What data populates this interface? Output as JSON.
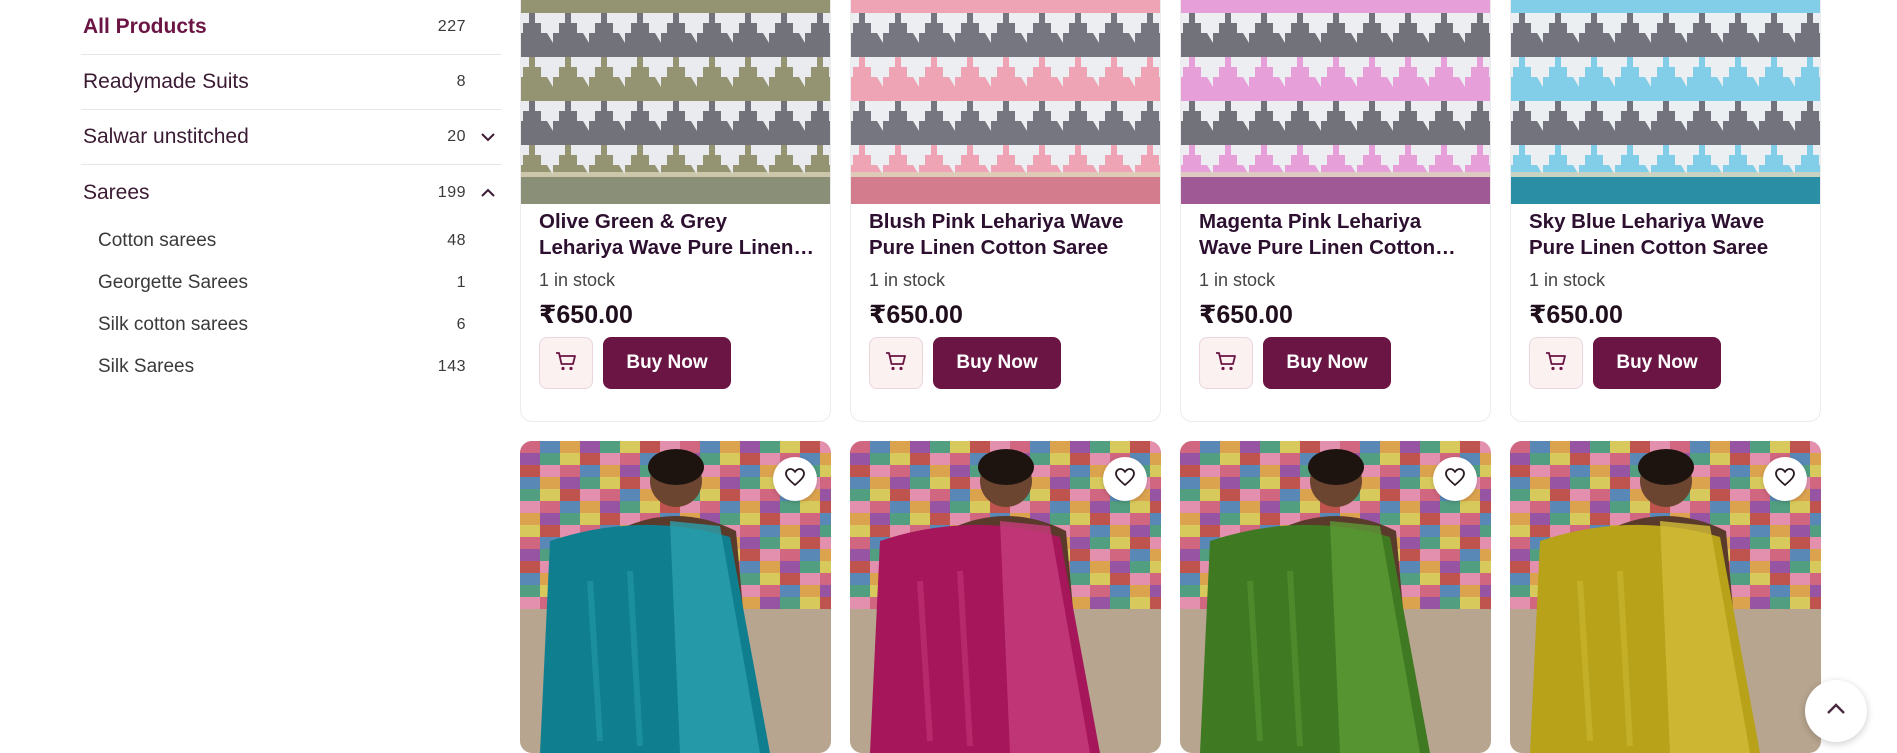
{
  "sidebar": {
    "categories": [
      {
        "label": "All Products",
        "count": "227"
      },
      {
        "label": "Readymade Suits",
        "count": "8"
      },
      {
        "label": "Salwar unstitched",
        "count": "20"
      },
      {
        "label": "Sarees",
        "count": "199"
      }
    ],
    "subcategories": [
      {
        "label": "Cotton sarees",
        "count": "48"
      },
      {
        "label": "Georgette Sarees",
        "count": "1"
      },
      {
        "label": "Silk cotton sarees",
        "count": "6"
      },
      {
        "label": "Silk Sarees",
        "count": "143"
      }
    ]
  },
  "products": [
    {
      "title": "Olive Green & Grey Lehariya Wave Pure Linen Cotton Saree",
      "stock": "1 in stock",
      "price": "₹650.00",
      "buy_label": "Buy Now",
      "colors": {
        "a": "#8f8f6a",
        "b": "#6b6b74",
        "c": "#e9ebef",
        "border": "#8a8f78"
      }
    },
    {
      "title": "Blush Pink Lehariya Wave Pure Linen Cotton Saree",
      "stock": "1 in stock",
      "price": "₹650.00",
      "buy_label": "Buy Now",
      "colors": {
        "a": "#ee9fb0",
        "b": "#6f6f78",
        "c": "#eceef2",
        "border": "#d27c8e"
      }
    },
    {
      "title": "Magenta Pink Lehariya Wave Pure Linen Cotton Saree",
      "stock": "1 in stock",
      "price": "₹650.00",
      "buy_label": "Buy Now",
      "colors": {
        "a": "#e79ad8",
        "b": "#6c6a74",
        "c": "#eceef2",
        "border": "#9f5a96"
      }
    },
    {
      "title": "Sky Blue Lehariya Wave Pure Linen Cotton Saree",
      "stock": "1 in stock",
      "price": "₹650.00",
      "buy_label": "Buy Now",
      "colors": {
        "a": "#7ccbe8",
        "b": "#6c6c76",
        "c": "#eceff2",
        "border": "#2a8fa4"
      }
    }
  ],
  "row2_products": [
    {
      "saree": "#0f7f90",
      "accent": "#2aa0ad"
    },
    {
      "saree": "#a6165a",
      "accent": "#c73d7c"
    },
    {
      "saree": "#3f7a22",
      "accent": "#5d9a36"
    },
    {
      "saree": "#b7a21a",
      "accent": "#d2bd38"
    }
  ],
  "theme": {
    "accent": "#6a1543"
  }
}
